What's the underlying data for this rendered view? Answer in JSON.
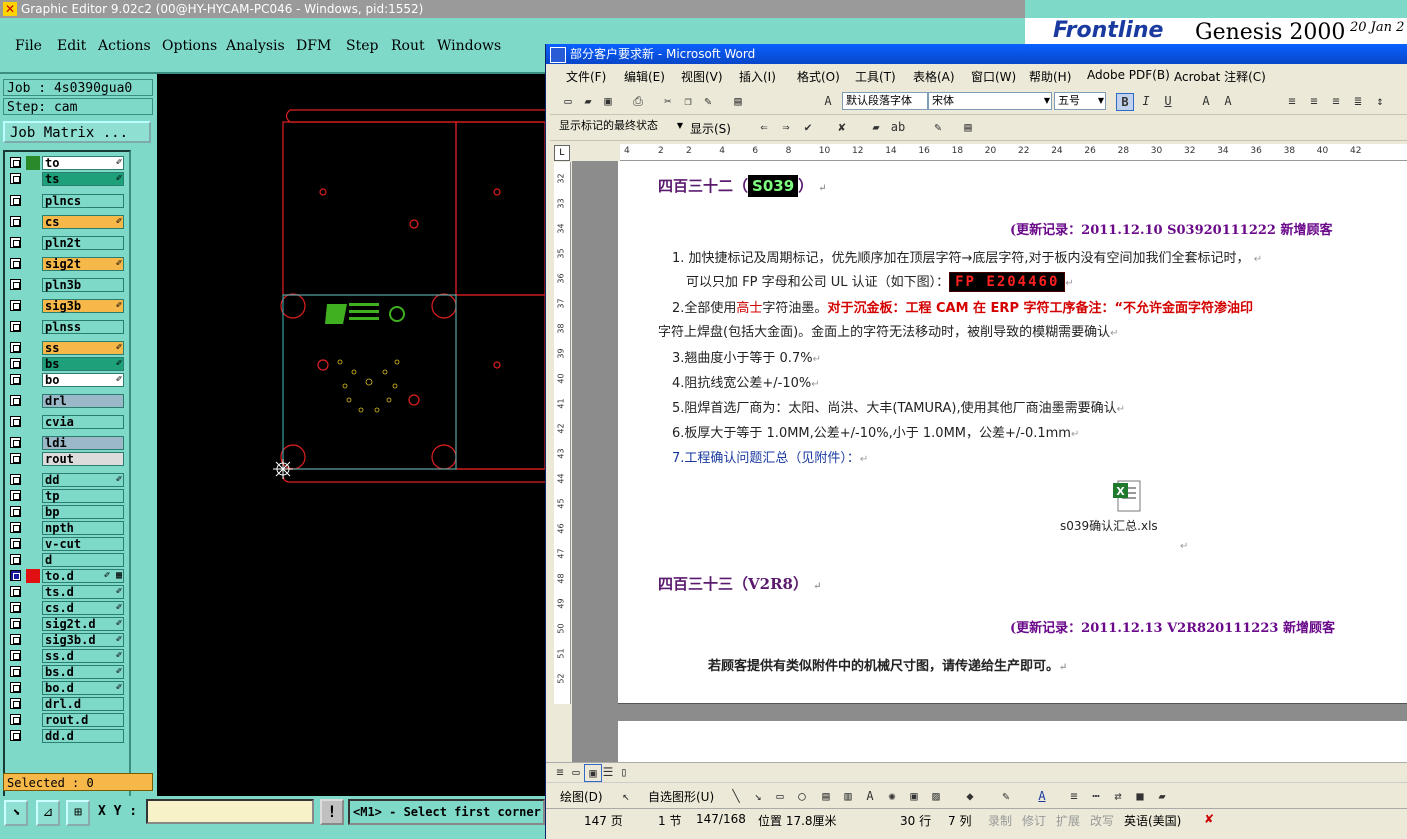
{
  "genesis": {
    "title": "Graphic Editor 9.02c2 (00@HY-HYCAM-PC046 - Windows, pid:1552)",
    "menu": [
      "File",
      "Edit",
      "Actions",
      "Options",
      "Analysis",
      "DFM",
      "Step",
      "Rout",
      "Windows"
    ],
    "job": "Job : 4s0390gua0",
    "step": "Step: cam",
    "job_matrix": "Job Matrix ...",
    "layers": [
      {
        "name": "to",
        "bg": "#ffffff",
        "swatch": "#2a8a2a",
        "mark": "✐"
      },
      {
        "name": "ts",
        "bg": "#1ea07a",
        "swatch": "",
        "mark": "✐"
      },
      {
        "name": "plncs",
        "bg": "#7fd9c9",
        "swatch": "",
        "mark": ""
      },
      {
        "name": "cs",
        "bg": "#f7b84a",
        "swatch": "",
        "mark": "✐"
      },
      {
        "name": "pln2t",
        "bg": "#7fd9c9",
        "swatch": "",
        "mark": ""
      },
      {
        "name": "sig2t",
        "bg": "#f7b84a",
        "swatch": "",
        "mark": "✐"
      },
      {
        "name": "pln3b",
        "bg": "#7fd9c9",
        "swatch": "",
        "mark": ""
      },
      {
        "name": "sig3b",
        "bg": "#f7b84a",
        "swatch": "",
        "mark": "✐"
      },
      {
        "name": "plnss",
        "bg": "#7fd9c9",
        "swatch": "",
        "mark": ""
      },
      {
        "name": "ss",
        "bg": "#f7b84a",
        "swatch": "",
        "mark": "✐"
      },
      {
        "name": "bs",
        "bg": "#1ea07a",
        "swatch": "",
        "mark": "✐"
      },
      {
        "name": "bo",
        "bg": "#ffffff",
        "swatch": "",
        "mark": "✐"
      },
      {
        "name": "drl",
        "bg": "#9ab8c8",
        "swatch": "",
        "mark": ""
      },
      {
        "name": "cvia",
        "bg": "#7fd9c9",
        "swatch": "",
        "mark": ""
      },
      {
        "name": "ldi",
        "bg": "#9ab8c8",
        "swatch": "",
        "mark": ""
      },
      {
        "name": "rout",
        "bg": "#dcdcdc",
        "swatch": "",
        "mark": ""
      },
      {
        "name": "dd",
        "bg": "#7fd9c9",
        "swatch": "",
        "mark": "✐"
      },
      {
        "name": "tp",
        "bg": "#7fd9c9",
        "swatch": "",
        "mark": ""
      },
      {
        "name": "bp",
        "bg": "#7fd9c9",
        "swatch": "",
        "mark": ""
      },
      {
        "name": "npth",
        "bg": "#7fd9c9",
        "swatch": "",
        "mark": ""
      },
      {
        "name": "v-cut",
        "bg": "#7fd9c9",
        "swatch": "",
        "mark": ""
      },
      {
        "name": "d",
        "bg": "#7fd9c9",
        "swatch": "",
        "mark": ""
      },
      {
        "name": "to.d",
        "bg": "#7fd9c9",
        "swatch": "#e01010",
        "mark": "✐ ▦"
      },
      {
        "name": "ts.d",
        "bg": "#7fd9c9",
        "swatch": "",
        "mark": "✐"
      },
      {
        "name": "cs.d",
        "bg": "#7fd9c9",
        "swatch": "",
        "mark": "✐"
      },
      {
        "name": "sig2t.d",
        "bg": "#7fd9c9",
        "swatch": "",
        "mark": "✐"
      },
      {
        "name": "sig3b.d",
        "bg": "#7fd9c9",
        "swatch": "",
        "mark": "✐"
      },
      {
        "name": "ss.d",
        "bg": "#7fd9c9",
        "swatch": "",
        "mark": "✐"
      },
      {
        "name": "bs.d",
        "bg": "#7fd9c9",
        "swatch": "",
        "mark": "✐"
      },
      {
        "name": "bo.d",
        "bg": "#7fd9c9",
        "swatch": "",
        "mark": "✐"
      },
      {
        "name": "drl.d",
        "bg": "#7fd9c9",
        "swatch": "",
        "mark": ""
      },
      {
        "name": "rout.d",
        "bg": "#7fd9c9",
        "swatch": "",
        "mark": ""
      },
      {
        "name": "dd.d",
        "bg": "#7fd9c9",
        "swatch": "",
        "mark": ""
      }
    ],
    "selected": "Selected : 0",
    "xy_label": "X Y :",
    "prompt": "<M1> - Select first corner"
  },
  "banner": {
    "brand": "Frontline",
    "product": "Genesis 2000",
    "date": "20 Jan 2"
  },
  "word": {
    "title": "部分客户要求新 - Microsoft Word",
    "menu": [
      "文件(F)",
      "编辑(E)",
      "视图(V)",
      "插入(I)",
      "格式(O)",
      "工具(T)",
      "表格(A)",
      "窗口(W)",
      "帮助(H)",
      "Adobe PDF(B)",
      "Acrobat 注释(C)"
    ],
    "style_combo": "默认段落字体",
    "font_combo": "宋体",
    "size_combo": "五号",
    "markup_combo": "显示标记的最终状态",
    "show_btn": "显示(S)",
    "ruler_marks": [
      "4",
      "2",
      "2",
      "4",
      "6",
      "8",
      "10",
      "12",
      "14",
      "16",
      "18",
      "20",
      "22",
      "24",
      "26",
      "28",
      "30",
      "32",
      "34",
      "36",
      "38",
      "40",
      "42"
    ],
    "vruler_marks": [
      "32",
      "33",
      "34",
      "35",
      "36",
      "37",
      "38",
      "39",
      "40",
      "41",
      "42",
      "43",
      "44",
      "45",
      "46",
      "47",
      "48",
      "49",
      "50",
      "51",
      "52"
    ],
    "doc": {
      "h1_prefix": "四百三十二（",
      "h1_tag": "S039",
      "h1_suffix": "）",
      "update1": "(更新记录：2011.12.10      S03920111222      新增顾客",
      "item1a": "1. 加快捷标记及周期标记，优先顺序加在顶层字符→底层字符,对于板内没有空间加我们全套标记时，",
      "item1b": "可以只加 FP 字母和公司 UL 认证（如下图）：",
      "fp": "FP E204460",
      "item2a_pre": "2.全部使用",
      "item2a_mid": "高士",
      "item2a_post": "字符油墨。",
      "item2a_red": "对于沉金板：工程 CAM 在 ERP 字符工序备注：“不允许金面字符渗油印",
      "item2b": "字符上焊盘(包括大金面)。金面上的字符无法移动时，被削导致的模糊需要确认",
      "item3": "3.翘曲度小于等于 0.7%",
      "item4": "4.阻抗线宽公差+/-10%",
      "item5": "5.阻焊首选厂商为：太阳、尚洪、大丰(TAMURA),使用其他厂商油墨需要确认",
      "item6": "6.板厚大于等于 1.0MM,公差+/-10%,小于 1.0MM，公差+/-0.1mm",
      "item7": "7.工程确认问题汇总（见附件）：",
      "attachment": "s039确认汇总.xls",
      "h2": "四百三十三（V2R8）",
      "update2": "(更新记录：2011.12.13      V2R820111223      新增顾客",
      "note": "若顾客提供有类似附件中的机械尺寸图，请传递给生产即可。"
    },
    "draw_label": "绘图(D)",
    "autoshape_label": "自选图形(U)",
    "status": {
      "page": "147 页",
      "section": "1 节",
      "pages": "147/168",
      "position": "位置 17.8厘米",
      "line": "30 行",
      "col": "7 列",
      "rec": "录制",
      "trk": "修订",
      "ext": "扩展",
      "ovr": "改写",
      "lang": "英语(美国)"
    }
  },
  "colors": {
    "genesis_bg": "#7fd9c9",
    "canvas_bg": "#000000",
    "board_outline": "#e02020",
    "profile": "#40c0c0",
    "silk": "#40b020"
  }
}
